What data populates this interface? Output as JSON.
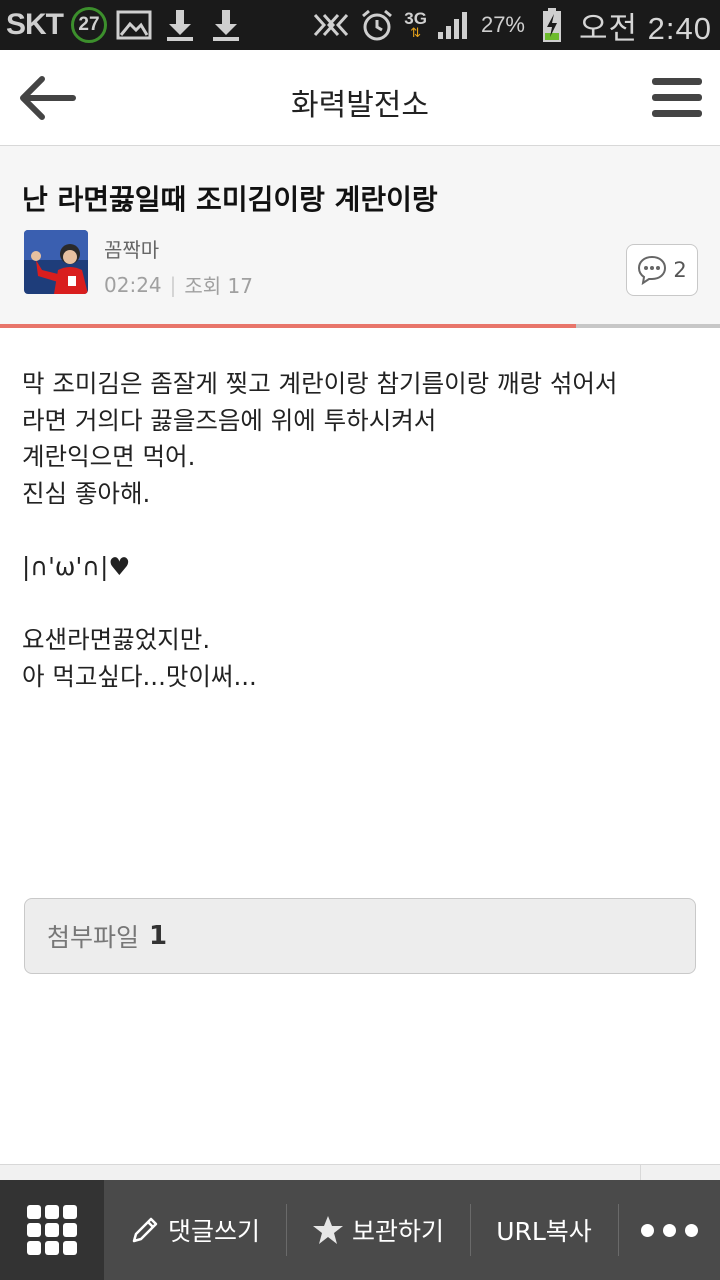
{
  "status_bar": {
    "carrier": "SKT",
    "notification_count": "27",
    "network": "3G",
    "battery": "27%",
    "time": "오전 2:40"
  },
  "header": {
    "title": "화력발전소",
    "back_icon": "back-arrow-icon",
    "menu_icon": "hamburger-menu-icon"
  },
  "post": {
    "title": "난 라면끓일때 조미김이랑 계란이랑",
    "author": "꼼짝마",
    "time": "02:24",
    "views_label": "조회 17",
    "comment_count": "2",
    "read_progress": 0.8,
    "body": [
      "막 조미김은 좀잘게 찢고 계란이랑 참기름이랑 깨랑 섞어서",
      "라면 거의다 끓을즈음에 위에 투하시켜서",
      "계란익으면 먹어.",
      "진심 좋아해.",
      "",
      "|∩'ω'∩|♥",
      "",
      "요샌라면끓었지만.",
      "아 먹고싶다...맛이써..."
    ]
  },
  "attachment": {
    "label": "첨부파일",
    "count": "1"
  },
  "bottom_bar": {
    "grid_icon": "grid-menu-icon",
    "comment_label": "댓글쓰기",
    "save_label": "보관하기",
    "url_label": "URL복사",
    "more_icon": "more-dots-icon"
  }
}
